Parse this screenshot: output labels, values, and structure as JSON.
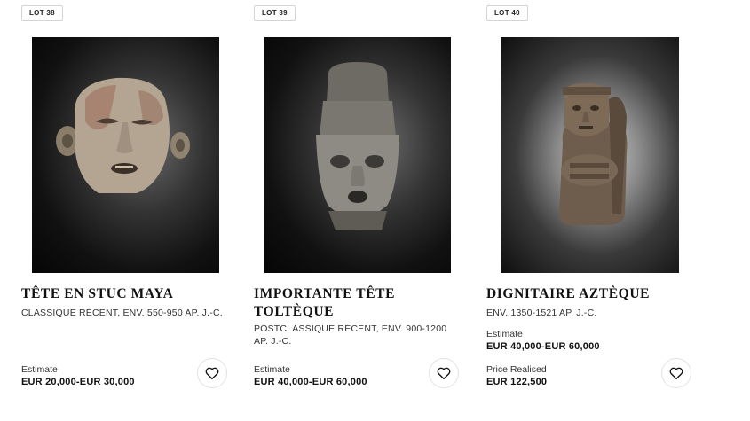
{
  "lots": [
    {
      "badge": "LOT 38",
      "title": "TÊTE EN STUC MAYA",
      "subtitle": "CLASSIQUE RÉCENT, ENV. 550-950 AP. J.-C.",
      "price_label": "Estimate",
      "price_value": "EUR 20,000-EUR 30,000",
      "image_icon": "maya-stucco-head-photo",
      "favorite_icon": "heart-outline-icon"
    },
    {
      "badge": "LOT 39",
      "title": "IMPORTANTE TÊTE TOLTÈQUE",
      "subtitle": "POSTCLASSIQUE RÉCENT, ENV. 900-1200 AP. J.-C.",
      "price_label": "Estimate",
      "price_value": "EUR 40,000-EUR 60,000",
      "image_icon": "toltec-stone-head-photo",
      "favorite_icon": "heart-outline-icon"
    },
    {
      "badge": "LOT 40",
      "title": "DIGNITAIRE AZTÈQUE",
      "subtitle": "ENV. 1350-1521 AP. J.-C.",
      "price_label": "Estimate",
      "price_value": "EUR 40,000-EUR 60,000",
      "realised_label": "Price Realised",
      "realised_value": "EUR 122,500",
      "image_icon": "aztec-seated-figure-photo",
      "favorite_icon": "heart-outline-icon"
    }
  ]
}
